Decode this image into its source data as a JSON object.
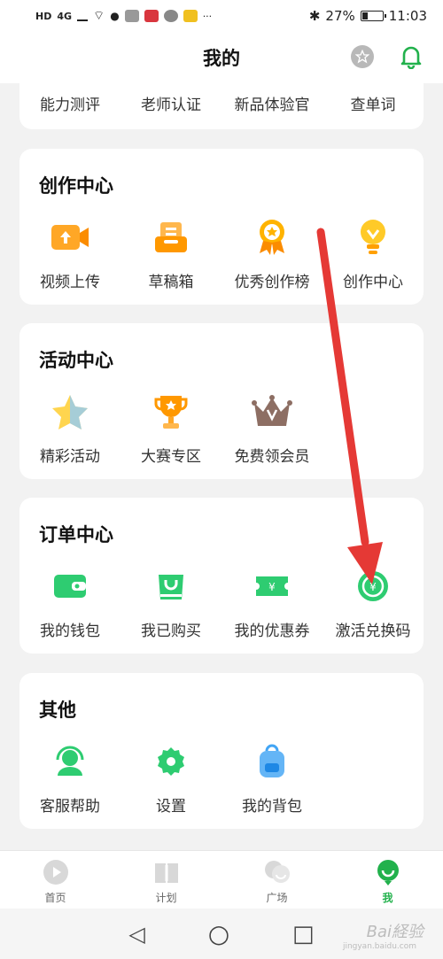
{
  "status": {
    "left_badges": [
      "HD",
      "4G"
    ],
    "bluetooth": "✱",
    "battery_percent": "27%",
    "time": "11:03",
    "battery_level": 0.27
  },
  "header": {
    "title": "我的",
    "star_icon": "star-icon",
    "bell_icon": "bell-icon",
    "accent": "#22b14c"
  },
  "top_row": {
    "items": [
      {
        "label": "能力测评"
      },
      {
        "label": "老师认证"
      },
      {
        "label": "新品体验官"
      },
      {
        "label": "查单词"
      }
    ]
  },
  "creation": {
    "title": "创作中心",
    "items": [
      {
        "label": "视频上传",
        "icon": "video-upload-icon"
      },
      {
        "label": "草稿箱",
        "icon": "drafts-icon"
      },
      {
        "label": "优秀创作榜",
        "icon": "award-medal-icon"
      },
      {
        "label": "创作中心",
        "icon": "lightbulb-icon"
      }
    ]
  },
  "activity": {
    "title": "活动中心",
    "items": [
      {
        "label": "精彩活动",
        "icon": "star-icon"
      },
      {
        "label": "大赛专区",
        "icon": "trophy-icon"
      },
      {
        "label": "免费领会员",
        "icon": "crown-icon"
      }
    ]
  },
  "orders": {
    "title": "订单中心",
    "items": [
      {
        "label": "我的钱包",
        "icon": "wallet-icon"
      },
      {
        "label": "我已购买",
        "icon": "shopping-bag-icon"
      },
      {
        "label": "我的优惠券",
        "icon": "coupon-icon"
      },
      {
        "label": "激活兑换码",
        "icon": "redeem-code-icon"
      }
    ]
  },
  "other": {
    "title": "其他",
    "items": [
      {
        "label": "客服帮助",
        "icon": "headset-icon"
      },
      {
        "label": "设置",
        "icon": "gear-icon"
      },
      {
        "label": "我的背包",
        "icon": "backpack-icon"
      }
    ]
  },
  "bottom_nav": {
    "items": [
      {
        "label": "首页",
        "icon": "home-play-icon"
      },
      {
        "label": "计划",
        "icon": "book-icon"
      },
      {
        "label": "广场",
        "icon": "chat-bubbles-icon"
      },
      {
        "label": "我",
        "icon": "profile-icon"
      }
    ],
    "active": "我"
  },
  "system_nav": {
    "back": "◁",
    "home": "○",
    "recent": "□"
  },
  "watermark": {
    "text": "Bai経验",
    "sub": "jingyan.baidu.com"
  },
  "annotation": {
    "arrow_color": "#e53935"
  }
}
